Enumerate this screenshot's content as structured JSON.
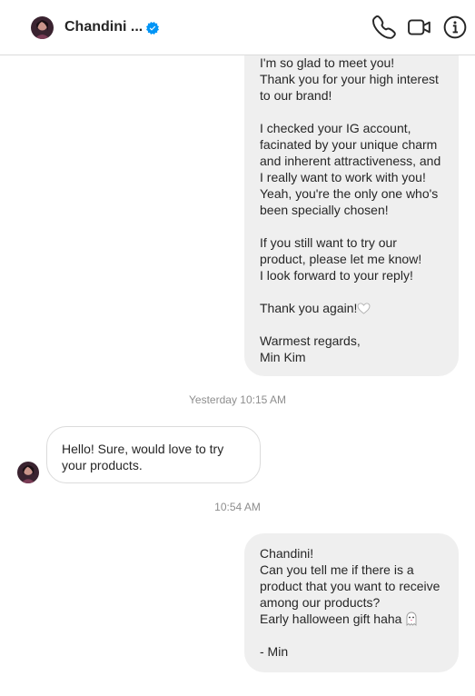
{
  "header": {
    "contact_name": "Chandini ...",
    "verified_icon": "verified-badge-icon",
    "icons": [
      "phone-icon",
      "video-call-icon",
      "info-icon"
    ]
  },
  "messages": [
    {
      "direction": "outgoing",
      "text_main": "I'm so glad to meet you!\nThank you for your high interest\nto our brand!\n\nI checked your IG account,\nfacinated by your unique charm\nand inherent attractiveness, and\nI really want to work with you!\nYeah, you're the only one who's\nbeen specially chosen!\n\nIf you still want to try our\nproduct, please let me know!\nI look forward to your reply!\n\nThank you again!",
      "text_tail": "\n\nWarmest regards,\nMin Kim",
      "emoji": "white-heart-icon"
    },
    {
      "direction": "incoming",
      "text": "Hello! Sure, would love to try\nyour products."
    },
    {
      "direction": "outgoing",
      "text_main": "Chandini!\nCan you tell me if there is a\nproduct that you want to receive\namong our products?\nEarly halloween gift haha ",
      "text_tail": "\n\n- Min",
      "emoji": "ghost-icon"
    }
  ],
  "timestamps": [
    "Yesterday 10:15 AM",
    "10:54 AM"
  ],
  "colors": {
    "outgoing_bubble": "#efefef",
    "incoming_border": "#dbdbdb",
    "timestamp_text": "#8e8e8e",
    "verified_blue": "#0095f6"
  }
}
